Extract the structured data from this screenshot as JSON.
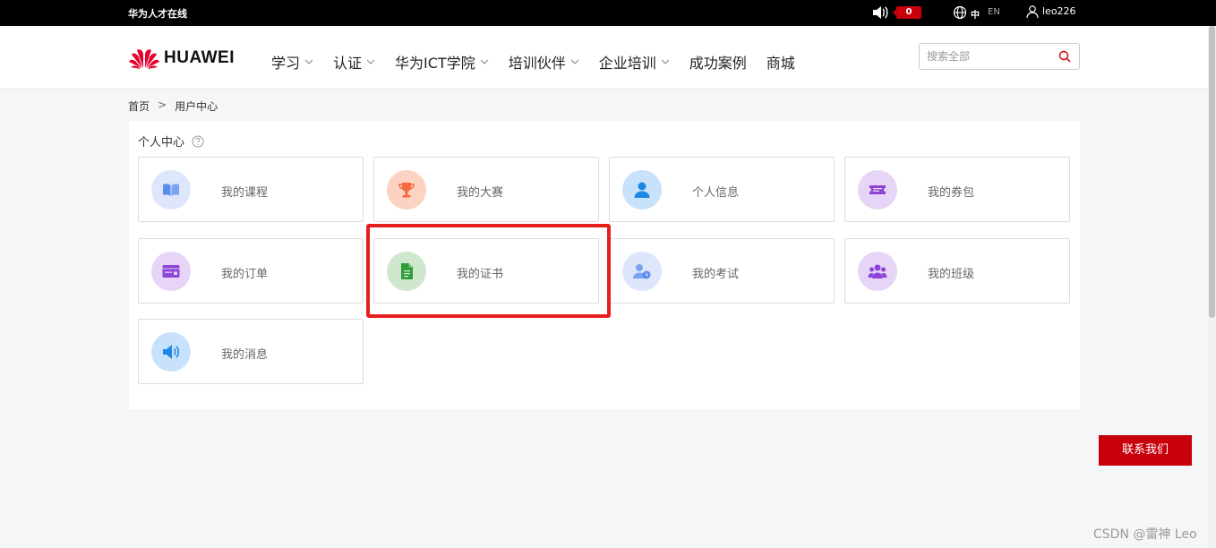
{
  "topbar": {
    "brand_text": "华为人才在线",
    "notification_count": "0",
    "lang_zh": "中",
    "lang_en": "EN",
    "username": "leo226"
  },
  "header": {
    "logo_text": "HUAWEI",
    "nav": [
      {
        "label": "学习",
        "has_dropdown": true
      },
      {
        "label": "认证",
        "has_dropdown": true
      },
      {
        "label": "华为ICT学院",
        "has_dropdown": true
      },
      {
        "label": "培训伙伴",
        "has_dropdown": true
      },
      {
        "label": "企业培训",
        "has_dropdown": true
      },
      {
        "label": "成功案例",
        "has_dropdown": false
      },
      {
        "label": "商城",
        "has_dropdown": false
      }
    ],
    "search_placeholder": "搜索全部"
  },
  "breadcrumb": {
    "home": "首页",
    "separator": ">",
    "current": "用户中心"
  },
  "panel": {
    "title": "个人中心",
    "cards": [
      {
        "label": "我的课程",
        "icon": "book-icon",
        "color": "#5b8def",
        "bg": "#dde6fb"
      },
      {
        "label": "我的大赛",
        "icon": "trophy-icon",
        "color": "#f26a3d",
        "bg": "#fcd3c2"
      },
      {
        "label": "个人信息",
        "icon": "person-icon",
        "color": "#1e88e5",
        "bg": "#c8e2fb"
      },
      {
        "label": "我的券包",
        "icon": "ticket-icon",
        "color": "#8e44d6",
        "bg": "#e6d5f6"
      },
      {
        "label": "我的订单",
        "icon": "order-icon",
        "color": "#8e44d6",
        "bg": "#e6d5f6"
      },
      {
        "label": "我的证书",
        "icon": "certificate-icon",
        "color": "#2e9e3a",
        "bg": "#cfe8cd"
      },
      {
        "label": "我的考试",
        "icon": "exam-icon",
        "color": "#5b8def",
        "bg": "#dde6fb"
      },
      {
        "label": "我的班级",
        "icon": "group-icon",
        "color": "#8e44d6",
        "bg": "#e6d5f6"
      },
      {
        "label": "我的消息",
        "icon": "speaker-icon",
        "color": "#1e88e5",
        "bg": "#c8e2fb"
      }
    ]
  },
  "contact_button": "联系我们",
  "watermark": "CSDN @雷神 Leo",
  "colors": {
    "brand_red": "#c7000b",
    "highlight_red": "#e61e1e"
  }
}
